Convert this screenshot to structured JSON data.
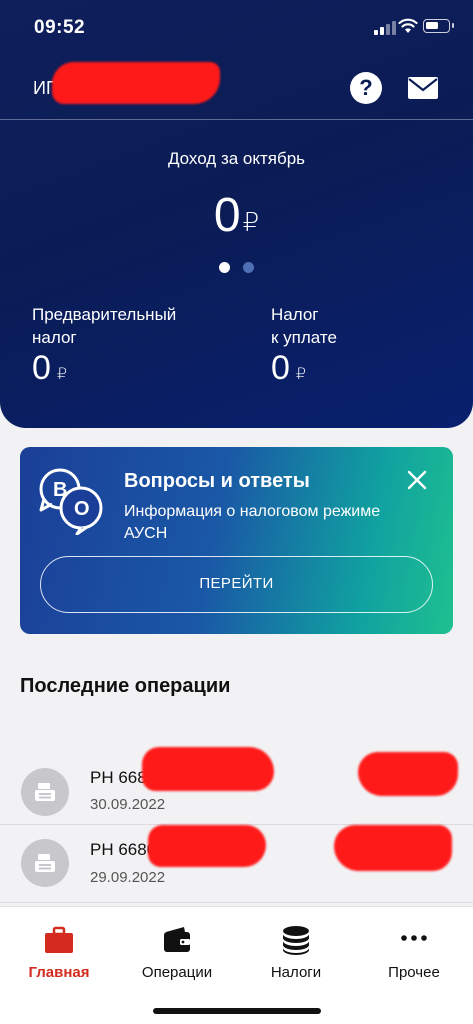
{
  "status": {
    "time": "09:52"
  },
  "header": {
    "account_prefix": "ИП",
    "help_symbol": "?"
  },
  "income": {
    "label": "Доход за октябрь",
    "value": "0",
    "currency": "₽",
    "carousel_pages": 2,
    "carousel_active": 1
  },
  "kpis": [
    {
      "label_line1": "Предварительный",
      "label_line2": "налог",
      "value": "0",
      "currency": "₽"
    },
    {
      "label_line1": "Налог",
      "label_line2": "к уплате",
      "value": "0",
      "currency": "₽"
    }
  ],
  "faq": {
    "title": "Вопросы и ответы",
    "text": "Информация о налоговом режиме АУСН",
    "button": "ПЕРЕЙТИ",
    "icon_letters": [
      "В",
      "О"
    ]
  },
  "operations": {
    "title": "Последние операции",
    "items": [
      {
        "title": "РН 668",
        "date": "30.09.2022"
      },
      {
        "title": "РН 6680",
        "date": "29.09.2022"
      }
    ]
  },
  "tabs": [
    {
      "label": "Главная",
      "icon": "briefcase-icon",
      "active": true
    },
    {
      "label": "Операции",
      "icon": "wallet-icon",
      "active": false
    },
    {
      "label": "Налоги",
      "icon": "coins-icon",
      "active": false
    },
    {
      "label": "Прочее",
      "icon": "more-icon",
      "active": false
    }
  ],
  "colors": {
    "brand_dark": "#0b1c55",
    "accent_red": "#d52b1e"
  }
}
